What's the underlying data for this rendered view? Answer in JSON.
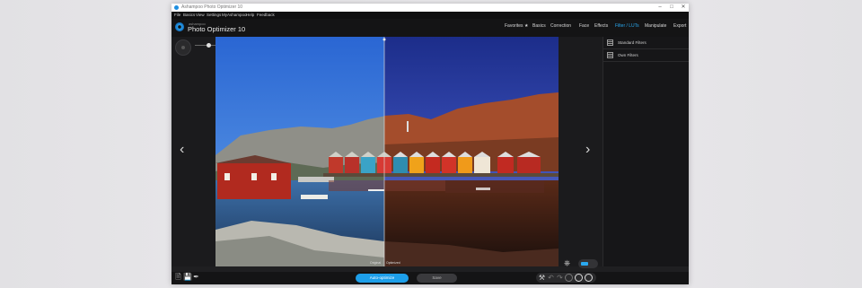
{
  "window": {
    "title": "Ashampoo Photo Optimizer 10"
  },
  "menu": [
    "File",
    "Basics",
    "View",
    "Settings",
    "MyAshampoo",
    "Help",
    "Feedback"
  ],
  "brand": {
    "small": "ashampoo",
    "name": "Photo Optimizer 10"
  },
  "nav": {
    "tabs": [
      {
        "label": "Favorites ★",
        "active": false
      },
      {
        "label": "Basics",
        "active": false
      },
      {
        "label": "Correction",
        "active": false
      },
      {
        "label": "Face",
        "active": false
      },
      {
        "label": "Effects",
        "active": false
      },
      {
        "label": "Filter / LUTs",
        "active": true
      },
      {
        "label": "Manipulate",
        "active": false
      },
      {
        "label": "Export",
        "active": false
      }
    ]
  },
  "panel": {
    "items": [
      "Standard Filters",
      "Own Filters"
    ]
  },
  "image": {
    "label_left": "Original",
    "label_right": "Optimized"
  },
  "toolbar": {
    "primary": "Auto-optimize",
    "secondary": "Save"
  },
  "colors": {
    "accent": "#2aa9f0",
    "button": "#1d9fea",
    "bg": "#1f1f21"
  },
  "icons": {
    "prev": "chevron-left-icon",
    "next": "chevron-right-icon",
    "compare": "compare-icon",
    "toolbar": [
      "file-icon",
      "save-icon",
      "brush-icon",
      "tools-icon",
      "undo-icon",
      "redo-icon",
      "rotate-icon",
      "history-icon",
      "settings-icon"
    ]
  }
}
